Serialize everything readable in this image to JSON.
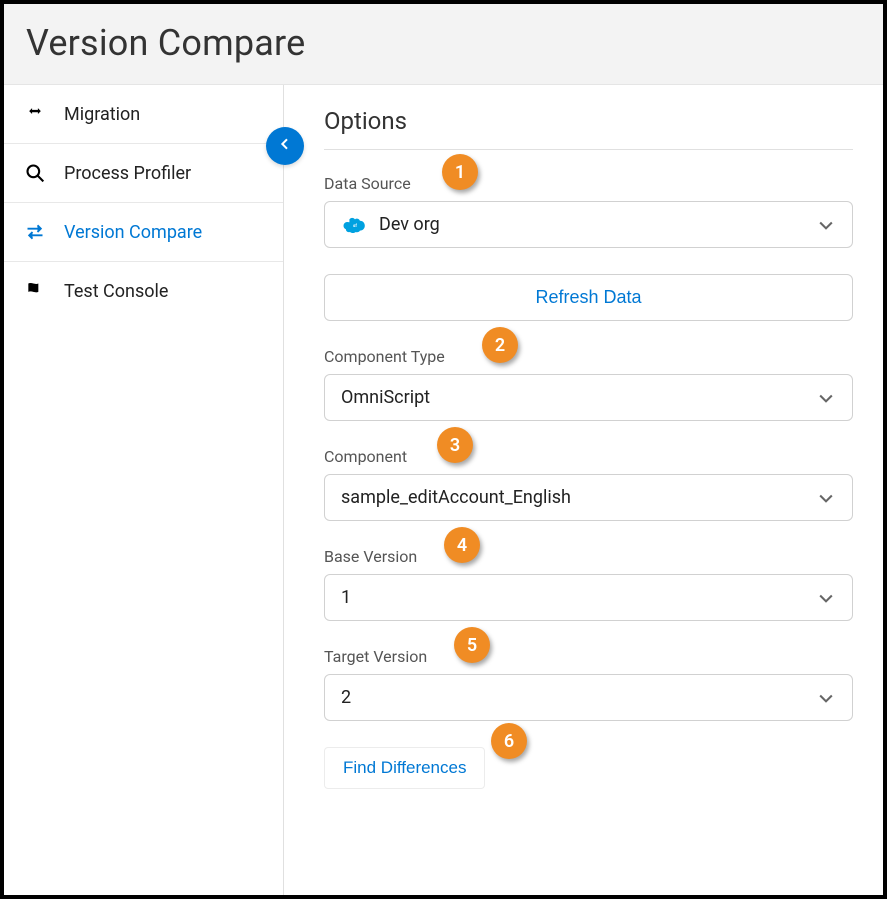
{
  "header": {
    "title": "Version Compare"
  },
  "sidebar": {
    "items": [
      {
        "label": "Migration"
      },
      {
        "label": "Process Profiler"
      },
      {
        "label": "Version Compare"
      },
      {
        "label": "Test Console"
      }
    ]
  },
  "main": {
    "title": "Options",
    "fields": {
      "dataSource": {
        "label": "Data Source",
        "value": "Dev org"
      },
      "refresh": {
        "label": "Refresh Data"
      },
      "componentType": {
        "label": "Component Type",
        "value": "OmniScript"
      },
      "component": {
        "label": "Component",
        "value": "sample_editAccount_English"
      },
      "baseVersion": {
        "label": "Base Version",
        "value": "1"
      },
      "targetVersion": {
        "label": "Target Version",
        "value": "2"
      },
      "findDifferences": {
        "label": "Find Differences"
      }
    }
  },
  "callouts": [
    "1",
    "2",
    "3",
    "4",
    "5",
    "6"
  ]
}
